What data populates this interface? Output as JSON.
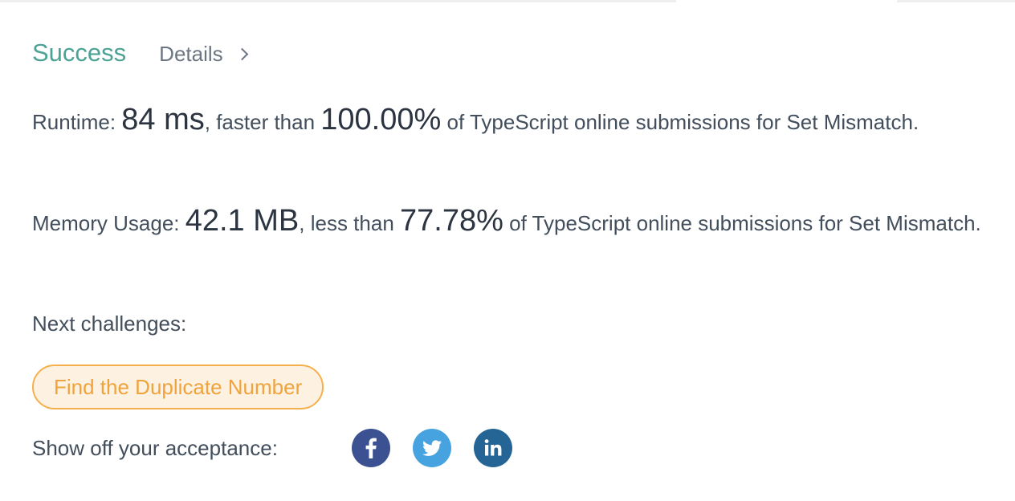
{
  "status": {
    "title": "Success",
    "details_label": "Details"
  },
  "runtime": {
    "label": "Runtime: ",
    "value": "84 ms",
    "comparison": ", faster than ",
    "percentile": "100.00%",
    "suffix": " of TypeScript online submissions for Set Mismatch."
  },
  "memory": {
    "label": "Memory Usage: ",
    "value": "42.1 MB",
    "comparison": ", less than ",
    "percentile": "77.78%",
    "suffix": " of TypeScript online submissions for Set Mismatch."
  },
  "next": {
    "label": "Next challenges:",
    "challenges": [
      "Find the Duplicate Number"
    ]
  },
  "share": {
    "label": "Show off your acceptance:",
    "icons": [
      "facebook-icon",
      "twitter-icon",
      "linkedin-icon"
    ]
  },
  "colors": {
    "success": "#4aa395",
    "challenge_border": "#f5b04b",
    "challenge_text": "#f0a33c",
    "facebook": "#3b5191",
    "twitter": "#46a3e0",
    "linkedin": "#256596"
  }
}
